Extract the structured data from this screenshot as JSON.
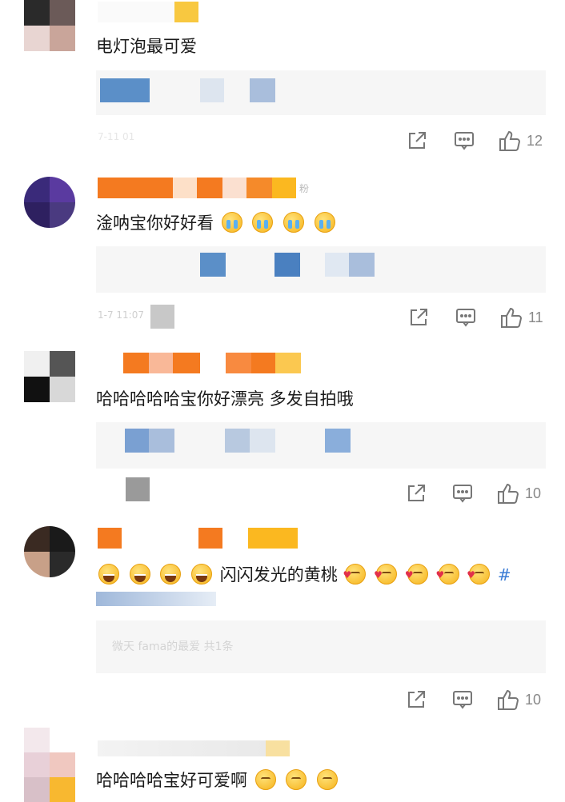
{
  "comments": [
    {
      "text": "电灯泡最可爱",
      "time": "7-11 01",
      "likes": "12"
    },
    {
      "text": "淦呐宝你好好看",
      "time": "1-7 11:07",
      "likes": "11"
    },
    {
      "text": "哈哈哈哈哈宝你好漂亮 多发自拍哦",
      "likes": "10"
    },
    {
      "text": "闪闪发光的黄桃",
      "hashtag": "#",
      "reply_faint": "微天 fama的最爱 共1条",
      "likes": "10"
    },
    {
      "text": "哈哈哈哈宝好可爱啊"
    }
  ],
  "icons": {
    "share": "share-icon",
    "reply": "comment-icon",
    "like": "thumbs-up-icon"
  }
}
